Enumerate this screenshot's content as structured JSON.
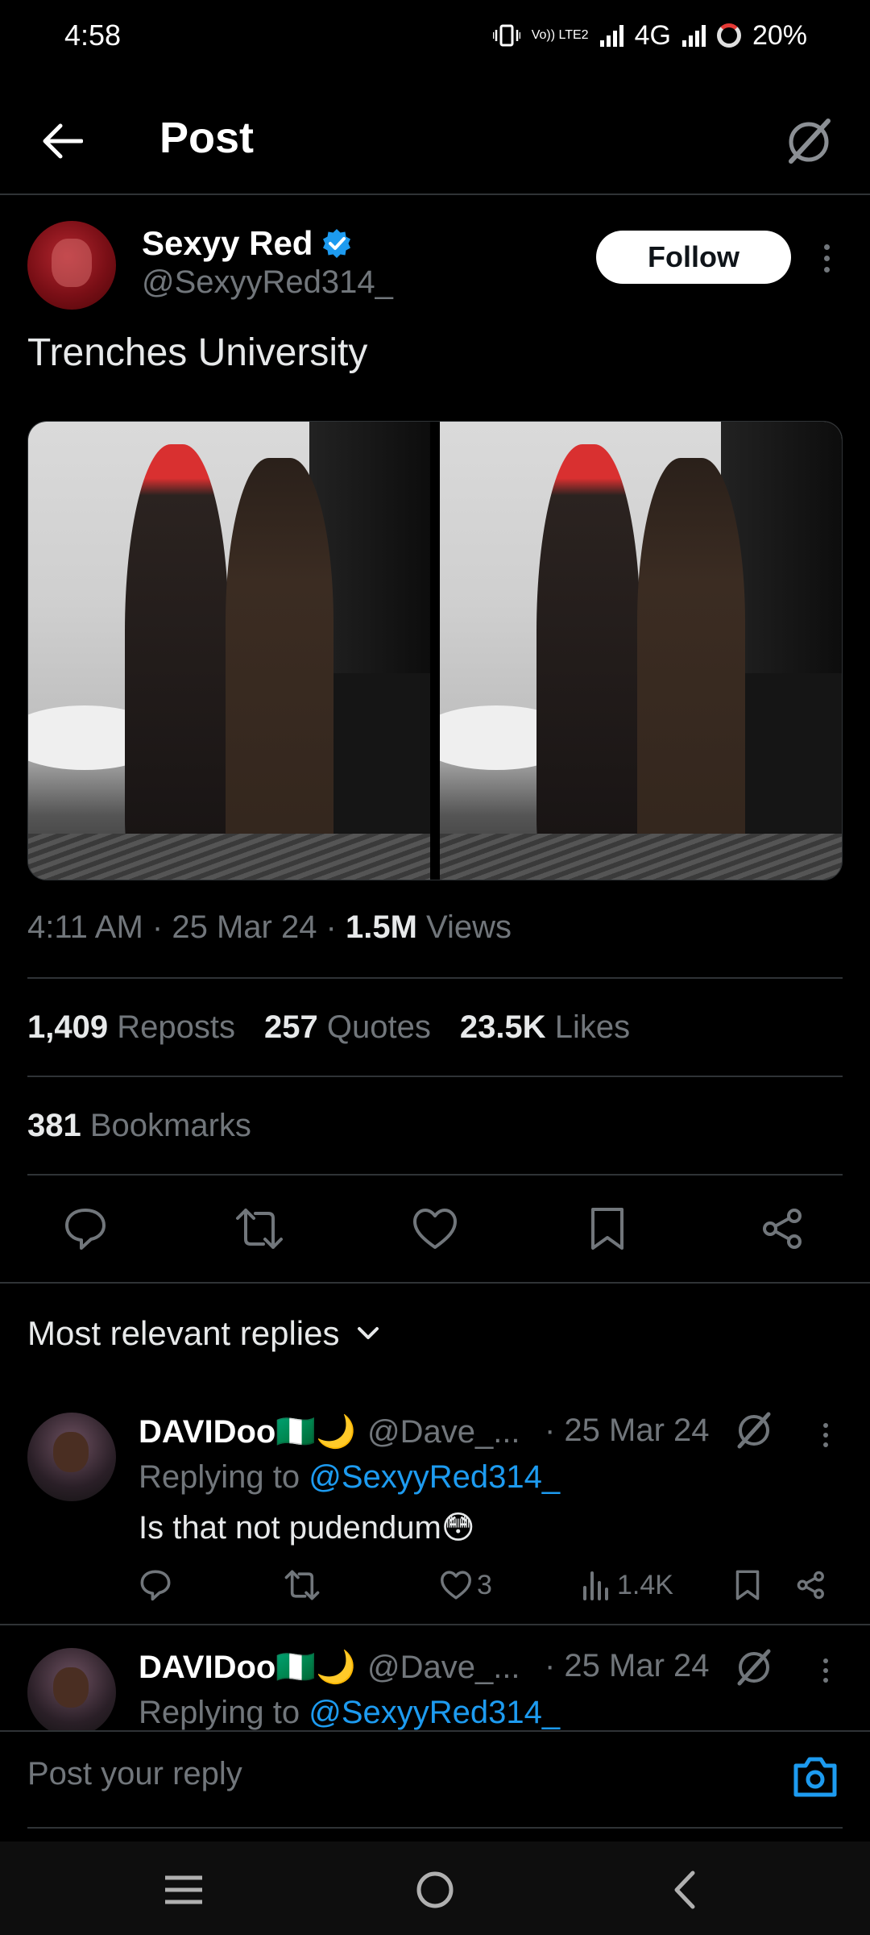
{
  "status_bar": {
    "time": "4:58",
    "volte_tag": "Vo)) LTE2",
    "network": "4G",
    "battery": "20%"
  },
  "header": {
    "title": "Post",
    "back_icon": "arrow-left-icon",
    "grok_icon": "grok-icon"
  },
  "post": {
    "author_name": "Sexyy Red",
    "author_handle": "@SexyyRed314_",
    "verified": true,
    "follow_label": "Follow",
    "text": "Trenches University",
    "timestamp": "4:11 AM · 25 Mar 24 · ",
    "views_count": "1.5M",
    "views_label": " Views",
    "stats": {
      "reposts_count": "1,409",
      "reposts_label": "Reposts",
      "quotes_count": "257",
      "quotes_label": "Quotes",
      "likes_count": "23.5K",
      "likes_label": "Likes",
      "bookmarks_count": "381",
      "bookmarks_label": "Bookmarks"
    },
    "media_count": 2
  },
  "replies": {
    "sort_label": "Most relevant replies",
    "items": [
      {
        "name": "DAVIDoo🇳🇬🌙",
        "handle": "@Dave_...",
        "date": "· 25 Mar 24",
        "replying_prefix": "Replying to ",
        "replying_to": "@SexyyRed314_",
        "text": "Is that not pudendum😳",
        "likes": "3",
        "views": "1.4K"
      },
      {
        "name": "DAVIDoo🇳🇬🌙",
        "handle": "@Dave_...",
        "date": "· 25 Mar 24",
        "replying_prefix": "Replying to ",
        "replying_to": "@SexyyRed314_"
      }
    ]
  },
  "composer": {
    "placeholder": "Post your reply"
  },
  "colors": {
    "background": "#000000",
    "accent": "#1d9bf0",
    "muted": "#71767b",
    "divider": "#2f3336"
  }
}
